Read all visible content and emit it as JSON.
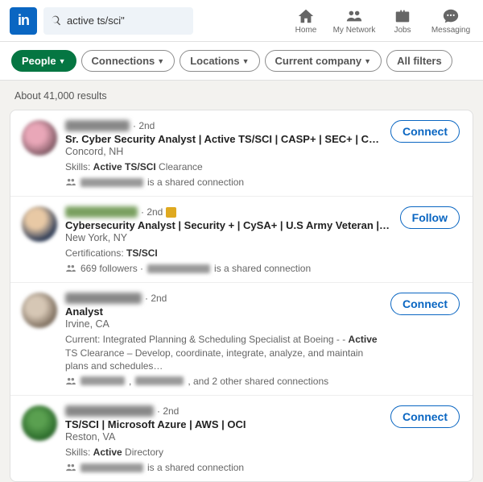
{
  "header": {
    "logo_text": "in",
    "search_value": "active ts/sci\"",
    "nav": [
      {
        "label": "Home"
      },
      {
        "label": "My Network"
      },
      {
        "label": "Jobs"
      },
      {
        "label": "Messaging"
      }
    ]
  },
  "filters": {
    "active": "People",
    "items": [
      "Connections",
      "Locations",
      "Current company"
    ],
    "all": "All filters"
  },
  "results_count": "About 41,000 results",
  "results": [
    {
      "degree": "· 2nd",
      "headline": "Sr. Cyber Security Analyst | Active TS/SCI | CASP+ | SEC+ | CEH | DNEA | IDA / NFA Cert…",
      "location": "Concord, NH",
      "meta_prefix": "Skills: ",
      "meta_bold": "Active TS/SCI",
      "meta_suffix": " Clearance",
      "mutual_suffix": " is a shared connection",
      "button": "Connect"
    },
    {
      "degree": "· 2nd",
      "premium": true,
      "headline": "Cybersecurity Analyst | Security + | CySA+ | U.S Army Veteran | Active TS/SCI Clearance",
      "location": "New York, NY",
      "meta_prefix": "Certifications: ",
      "meta_bold": "TS/SCI",
      "meta_suffix": "",
      "mutual_prefix": "669 followers · ",
      "mutual_suffix": " is a shared connection",
      "button": "Follow"
    },
    {
      "degree": "· 2nd",
      "headline": "Analyst",
      "location": "Irvine, CA",
      "meta_long_a": "Current: Integrated Planning & Scheduling Specialist at Boeing - - ",
      "meta_bold": "Active",
      "meta_long_b": " TS Clearance – Develop, coordinate, integrate, analyze, and maintain plans and schedules…",
      "mutual_suffix": ", and 2 other shared connections",
      "button": "Connect"
    },
    {
      "degree": "· 2nd",
      "headline": "TS/SCI | Microsoft Azure | AWS | OCI",
      "location": "Reston, VA",
      "meta_prefix": "Skills: ",
      "meta_bold": "Active",
      "meta_suffix": " Directory",
      "mutual_suffix": " is a shared connection",
      "button": "Connect"
    }
  ]
}
